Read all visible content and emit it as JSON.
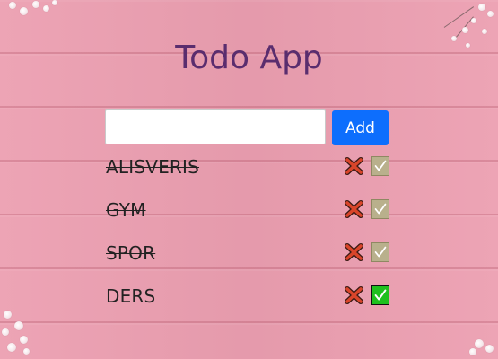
{
  "app": {
    "title": "Todo App"
  },
  "form": {
    "input_value": "",
    "input_placeholder": "",
    "add_label": "Add",
    "add_color": "#0d6efd"
  },
  "todos": [
    {
      "text": "ALISVERIS",
      "completed": true
    },
    {
      "text": "GYM",
      "completed": true
    },
    {
      "text": "SPOR",
      "completed": true
    },
    {
      "text": "DERS",
      "completed": false
    }
  ],
  "icons": {
    "delete": "cross-mark-icon",
    "check": "check-mark-icon"
  },
  "colors": {
    "title": "#5a2d6e",
    "background": "#ec9fb1",
    "delete": "#d9452a",
    "check_done": "#b9b08c",
    "check_active": "#1fc01f"
  }
}
